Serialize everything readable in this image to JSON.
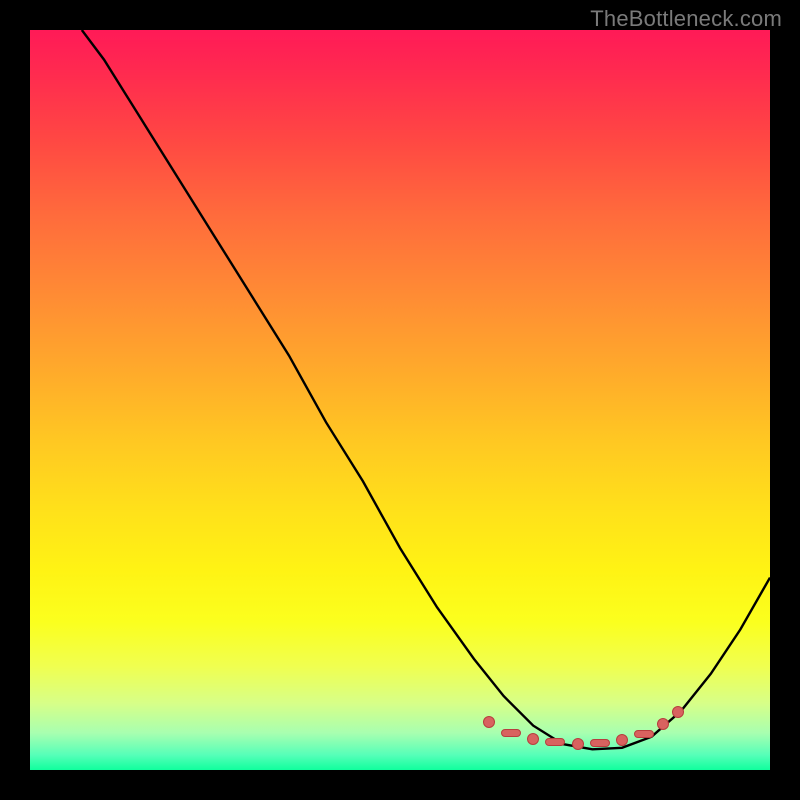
{
  "watermark": "TheBottleneck.com",
  "chart_data": {
    "type": "line",
    "title": "",
    "xlabel": "",
    "ylabel": "",
    "xlim": [
      0,
      1
    ],
    "ylim": [
      0,
      1
    ],
    "series": [
      {
        "name": "curve",
        "x": [
          0.07,
          0.1,
          0.15,
          0.2,
          0.25,
          0.3,
          0.35,
          0.4,
          0.45,
          0.5,
          0.55,
          0.6,
          0.64,
          0.68,
          0.72,
          0.76,
          0.8,
          0.84,
          0.88,
          0.92,
          0.96,
          1.0
        ],
        "y": [
          1.0,
          0.96,
          0.88,
          0.8,
          0.72,
          0.64,
          0.56,
          0.47,
          0.39,
          0.3,
          0.22,
          0.15,
          0.1,
          0.06,
          0.035,
          0.028,
          0.03,
          0.045,
          0.08,
          0.13,
          0.19,
          0.26
        ]
      }
    ],
    "markers": [
      {
        "x": 0.62,
        "y": 0.065,
        "shape": "round"
      },
      {
        "x": 0.65,
        "y": 0.05,
        "shape": "dash"
      },
      {
        "x": 0.68,
        "y": 0.042,
        "shape": "round"
      },
      {
        "x": 0.71,
        "y": 0.038,
        "shape": "dash"
      },
      {
        "x": 0.74,
        "y": 0.035,
        "shape": "round"
      },
      {
        "x": 0.77,
        "y": 0.036,
        "shape": "dash"
      },
      {
        "x": 0.8,
        "y": 0.04,
        "shape": "round"
      },
      {
        "x": 0.83,
        "y": 0.048,
        "shape": "dash"
      },
      {
        "x": 0.855,
        "y": 0.062,
        "shape": "round"
      },
      {
        "x": 0.875,
        "y": 0.078,
        "shape": "round"
      }
    ],
    "gradient": [
      "#ff1a57",
      "#ff6b3c",
      "#ffc922",
      "#fbff1e",
      "#10ff9d"
    ]
  }
}
